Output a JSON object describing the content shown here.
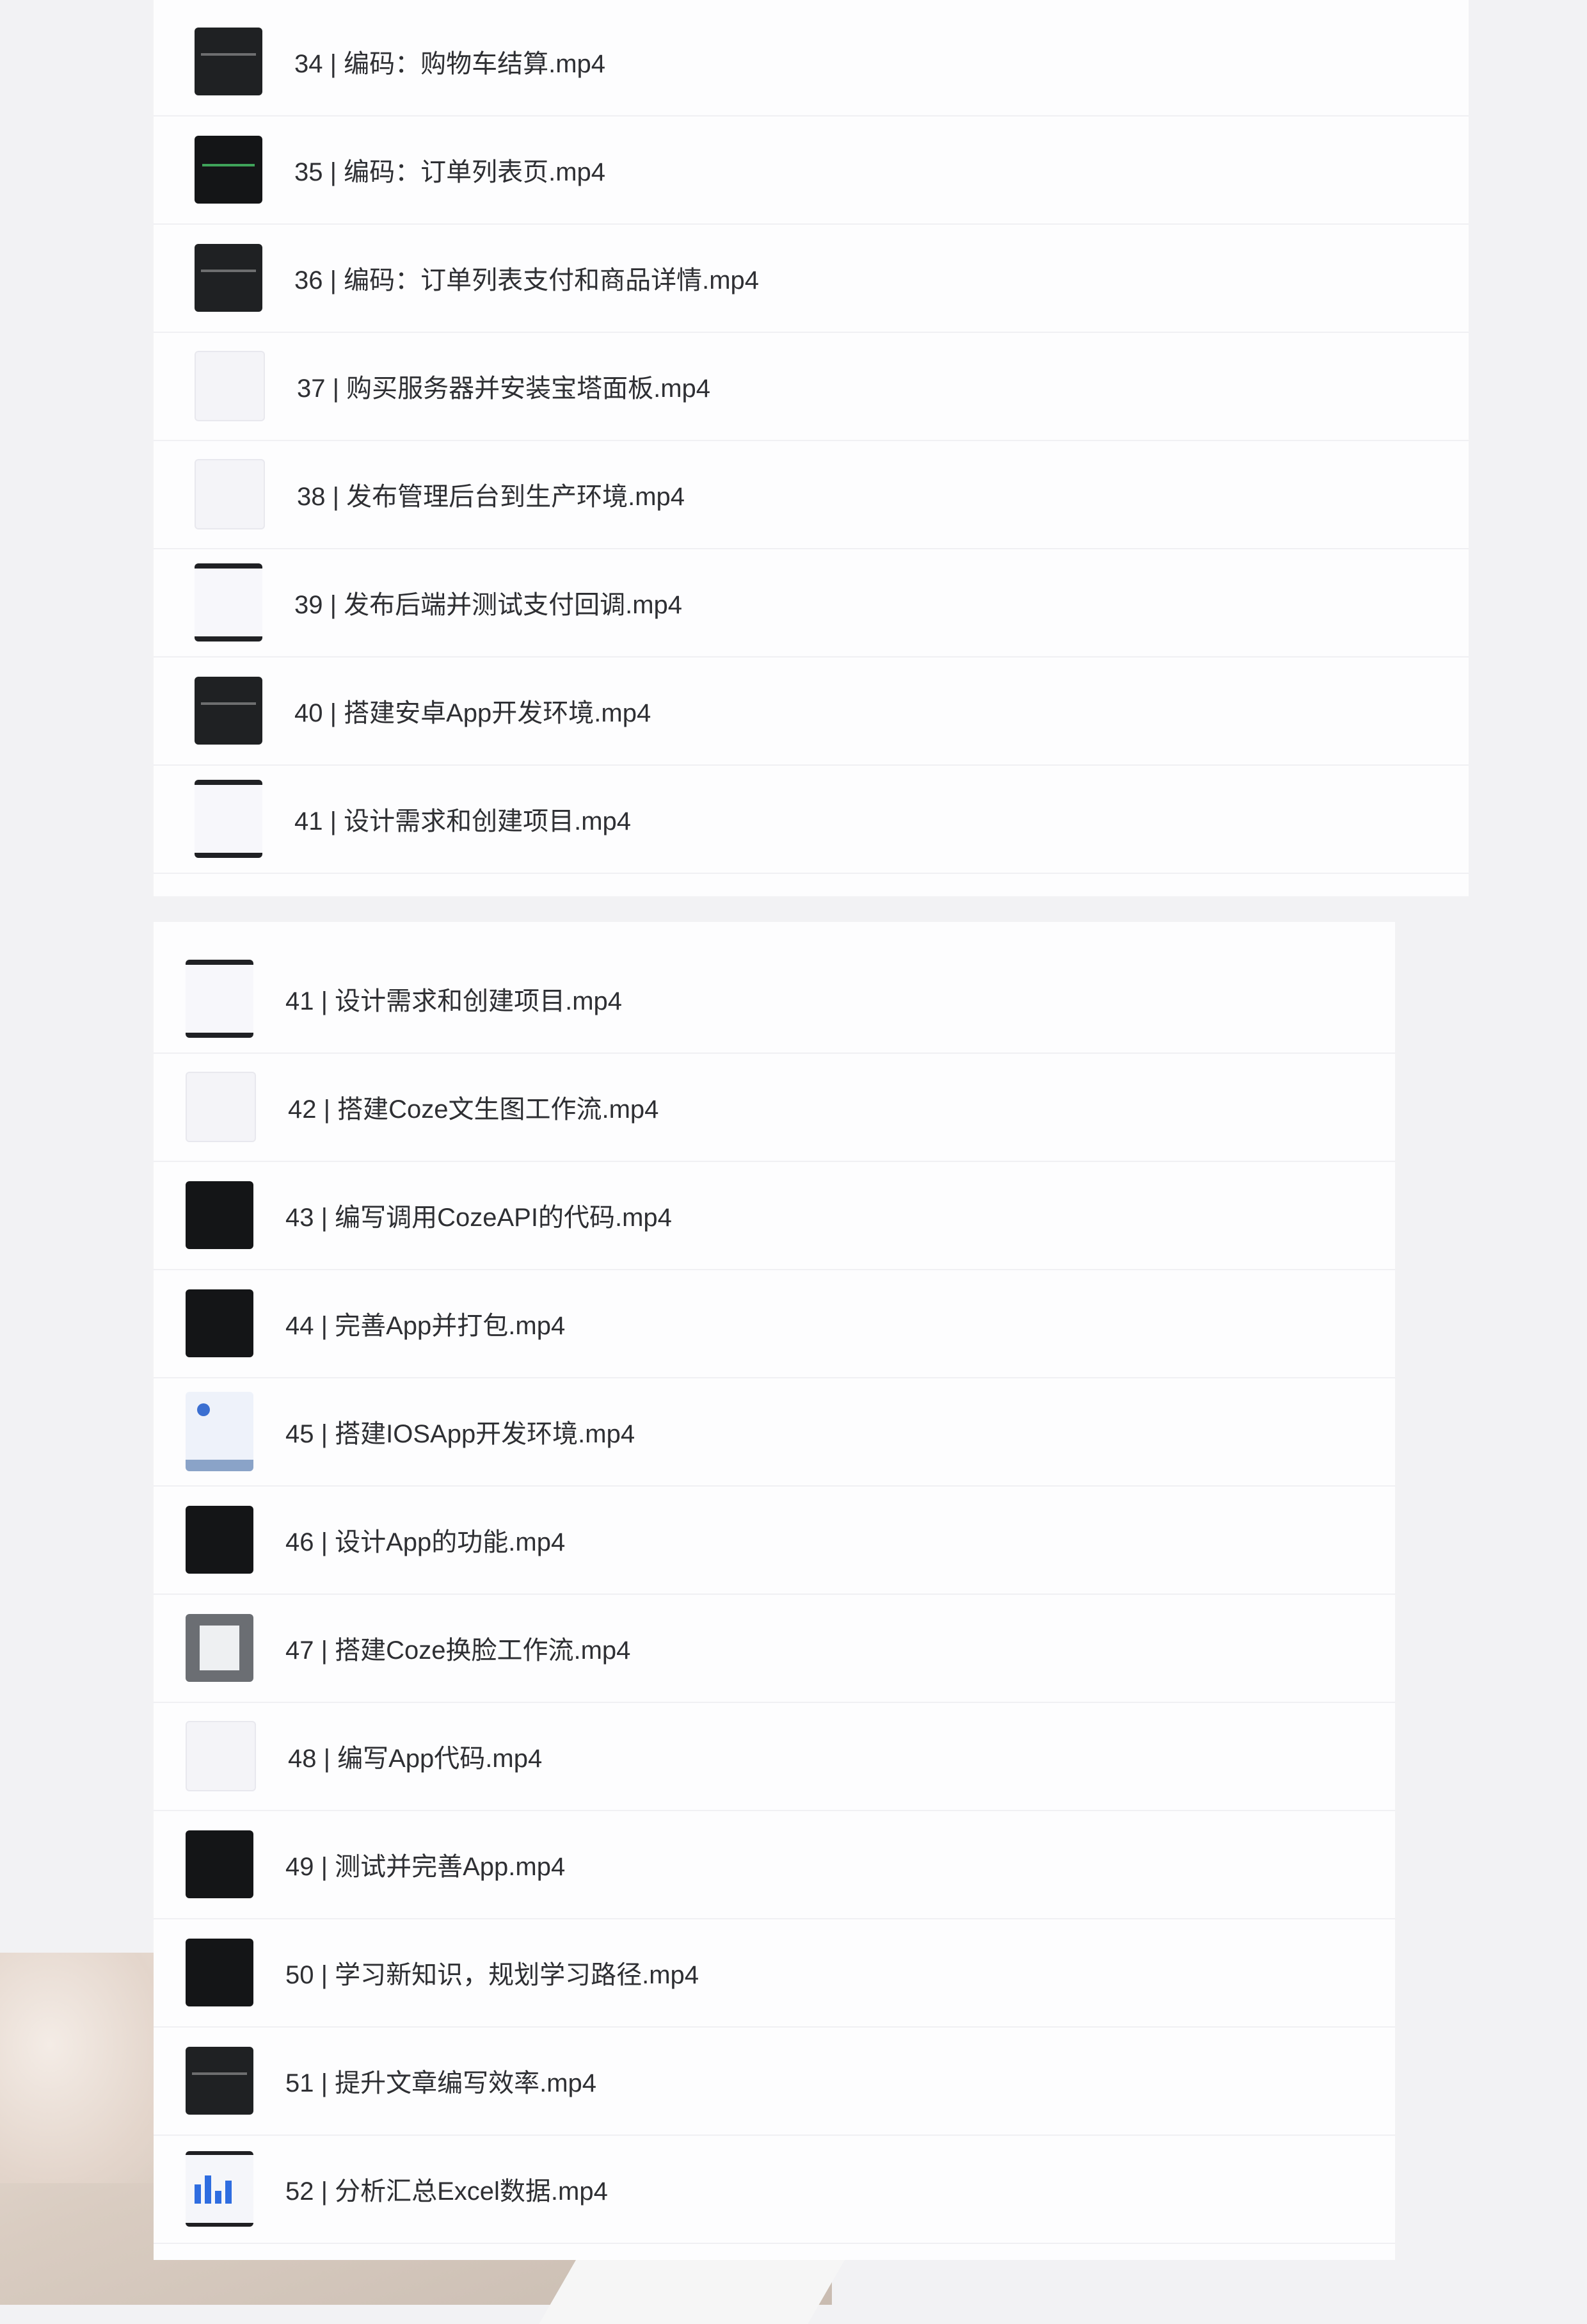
{
  "list_top": [
    {
      "label": "34 | 编码：购物车结算.mp4",
      "thumb": "dark"
    },
    {
      "label": "35 | 编码：订单列表页.mp4",
      "thumb": "green"
    },
    {
      "label": "36 | 编码：订单列表支付和商品详情.mp4",
      "thumb": "dark"
    },
    {
      "label": "37 | 购买服务器并安装宝塔面板.mp4",
      "thumb": "light"
    },
    {
      "label": "38 | 发布管理后台到生产环境.mp4",
      "thumb": "light"
    },
    {
      "label": "39 | 发布后端并测试支付回调.mp4",
      "thumb": "lightbar"
    },
    {
      "label": "40 | 搭建安卓App开发环境.mp4",
      "thumb": "dark"
    },
    {
      "label": "41 | 设计需求和创建项目.mp4",
      "thumb": "lightbar"
    }
  ],
  "list_bottom": [
    {
      "label": "41 | 设计需求和创建项目.mp4",
      "thumb": "lightbar"
    },
    {
      "label": "42 | 搭建Coze文生图工作流.mp4",
      "thumb": "light"
    },
    {
      "label": "43 | 编写调用CozeAPI的代码.mp4",
      "thumb": "dark2"
    },
    {
      "label": "44 | 完善App并打包.mp4",
      "thumb": "dark2"
    },
    {
      "label": "45 | 搭建IOSApp开发环境.mp4",
      "thumb": "blue"
    },
    {
      "label": "46 | 设计App的功能.mp4",
      "thumb": "dark2"
    },
    {
      "label": "47 | 搭建Coze换脸工作流.mp4",
      "thumb": "grey"
    },
    {
      "label": "48 | 编写App代码.mp4",
      "thumb": "light"
    },
    {
      "label": "49 | 测试并完善App.mp4",
      "thumb": "dark2"
    },
    {
      "label": "50 | 学习新知识，规划学习路径.mp4",
      "thumb": "dark2"
    },
    {
      "label": "51 | 提升文章编写效率.mp4",
      "thumb": "dark"
    },
    {
      "label": "52 | 分析汇总Excel数据.mp4",
      "thumb": "chart"
    }
  ],
  "colors": {
    "text": "#2e2f33",
    "panel": "#fdfdfe",
    "divider": "#f0f0f3"
  }
}
